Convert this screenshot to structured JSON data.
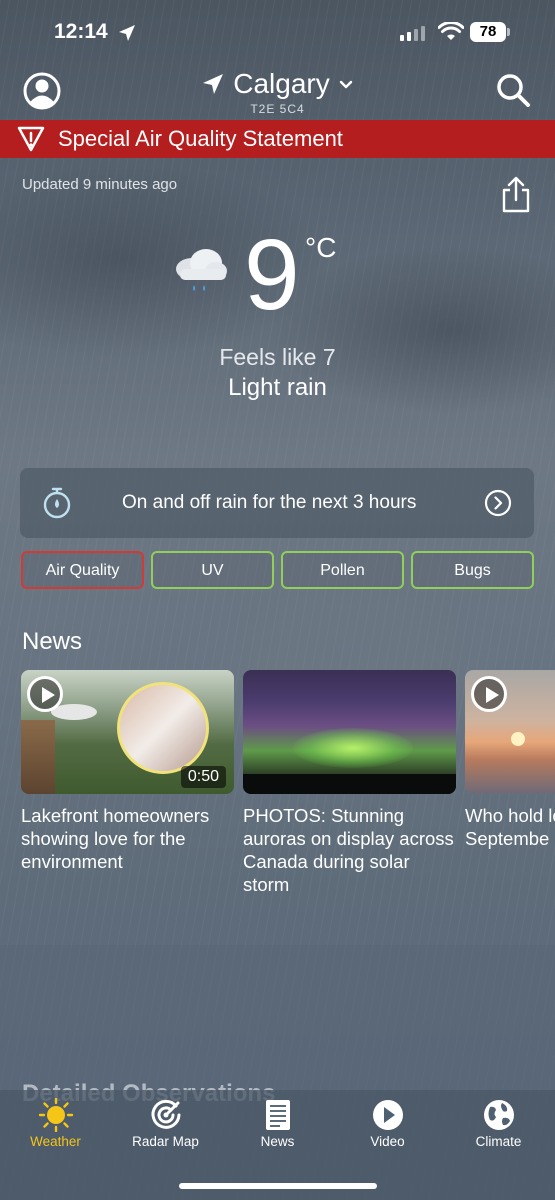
{
  "status_bar": {
    "time": "12:14",
    "battery": "78"
  },
  "header": {
    "location": "Calgary",
    "postal_code": "T2E 5C4"
  },
  "alert": {
    "text": "Special Air Quality Statement",
    "color": "#b51e1e"
  },
  "updated": "Updated 9 minutes ago",
  "current": {
    "temperature": "9",
    "unit": "°C",
    "feels_like": "Feels like 7",
    "condition": "Light rain"
  },
  "nowcast": {
    "text": "On and off rain for the next 3 hours"
  },
  "chips": [
    {
      "label": "Air Quality",
      "border_color": "#d23a36"
    },
    {
      "label": "UV",
      "border_color": "#8fcf5a"
    },
    {
      "label": "Pollen",
      "border_color": "#8fcf5a"
    },
    {
      "label": "Bugs",
      "border_color": "#8fcf5a"
    }
  ],
  "news": {
    "heading": "News",
    "items": [
      {
        "title": "Lakefront homeowners showing love for the environment",
        "duration": "0:50",
        "video": true
      },
      {
        "title": "PHOTOS: Stunning auroras on display across Canada during solar storm",
        "video": false
      },
      {
        "title": "Who hold longest-s Septembe",
        "video": true
      }
    ]
  },
  "detailed_observations": {
    "heading": "Detailed Observations"
  },
  "tabs": [
    {
      "label": "Weather",
      "icon": "sun-icon",
      "active": true
    },
    {
      "label": "Radar Map",
      "icon": "radar-icon",
      "active": false
    },
    {
      "label": "News",
      "icon": "newspaper-icon",
      "active": false
    },
    {
      "label": "Video",
      "icon": "play-circle-icon",
      "active": false
    },
    {
      "label": "Climate",
      "icon": "globe-icon",
      "active": false
    }
  ],
  "colors": {
    "active_tab": "#f5c518",
    "accent_alert": "#b51e1e"
  }
}
